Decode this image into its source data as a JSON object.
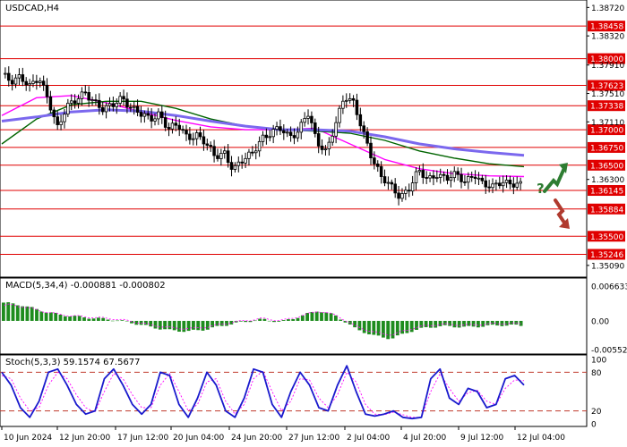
{
  "chart_data": [
    {
      "type": "candlestick",
      "title": "USDCAD,H4",
      "x_labels": [
        "10 Jun 2024",
        "12 Jun 20:00",
        "17 Jun 12:00",
        "20 Jun 04:00",
        "24 Jun 20:00",
        "27 Jun 12:00",
        "2 Jul 04:00",
        "4 Jul 20:00",
        "9 Jul 12:00",
        "12 Jul 04:00"
      ],
      "y_ticks": [
        "1.38720",
        "1.38320",
        "1.37910",
        "1.37510",
        "1.37110",
        "1.36300",
        "1.35090"
      ],
      "ylim": [
        1.3495,
        1.388
      ],
      "levels": [
        {
          "label": "1.38458",
          "value": 1.38458
        },
        {
          "label": "1.38000",
          "value": 1.38
        },
        {
          "label": "1.37623",
          "value": 1.37623
        },
        {
          "label": "1.37338",
          "value": 1.37338
        },
        {
          "label": "1.37000",
          "value": 1.37
        },
        {
          "label": "1.36750",
          "value": 1.3675
        },
        {
          "label": "1.36500",
          "value": 1.365
        },
        {
          "label": "1.36145",
          "value": 1.36145
        },
        {
          "label": "1.35884",
          "value": 1.35884
        },
        {
          "label": "1.35500",
          "value": 1.355
        },
        {
          "label": "1.35246",
          "value": 1.35246
        }
      ],
      "price_anchors": [
        1.3775,
        1.3768,
        1.3778,
        1.376,
        1.377,
        1.3745,
        1.3705,
        1.373,
        1.374,
        1.3755,
        1.374,
        1.3725,
        1.3735,
        1.3748,
        1.373,
        1.372,
        1.3715,
        1.3725,
        1.37,
        1.3705,
        1.369,
        1.3695,
        1.368,
        1.366,
        1.367,
        1.3645,
        1.3655,
        1.3665,
        1.369,
        1.3695,
        1.37,
        1.369,
        1.37,
        1.3725,
        1.368,
        1.367,
        1.371,
        1.3745,
        1.3735,
        1.37,
        1.366,
        1.363,
        1.362,
        1.3608,
        1.3618,
        1.364,
        1.363,
        1.364,
        1.363,
        1.3635,
        1.3628,
        1.364,
        1.362,
        1.3618,
        1.363,
        1.3625,
        1.362
      ],
      "moving_averages": [
        {
          "color": "#ff00ff",
          "values": [
            1.372,
            1.3745,
            1.3748,
            1.3738,
            1.3725,
            1.3713,
            1.3704,
            1.37,
            1.37,
            1.3702,
            1.368,
            1.3658,
            1.3645,
            1.3638,
            1.3635,
            1.3634
          ]
        },
        {
          "color": "#006400",
          "values": [
            1.368,
            1.3715,
            1.3735,
            1.374,
            1.374,
            1.373,
            1.3715,
            1.3705,
            1.37,
            1.3698,
            1.3695,
            1.3685,
            1.367,
            1.366,
            1.3652,
            1.3648
          ]
        },
        {
          "color": "#7b68ee",
          "values": [
            1.3712,
            1.3718,
            1.3725,
            1.3728,
            1.3726,
            1.372,
            1.3712,
            1.3705,
            1.37,
            1.37,
            1.3698,
            1.369,
            1.368,
            1.3673,
            1.3668,
            1.3664
          ]
        }
      ],
      "arrows": [
        {
          "direction": "up",
          "color": "#2e7d32"
        },
        {
          "direction": "down",
          "color": "#b03a2e"
        }
      ],
      "question_mark": "?"
    },
    {
      "type": "histogram",
      "title": "MACD(5,34,4) -0.000881 -0.000802",
      "y_ticks": [
        "0.006633",
        "0.00",
        "-0.005523"
      ],
      "ylim": [
        -0.006,
        0.007
      ],
      "anchors": [
        0.0035,
        0.003,
        0.002,
        0.0012,
        0.0008,
        0.0005,
        0.0002,
        -0.0004,
        -0.0012,
        -0.0018,
        -0.002,
        -0.0016,
        -0.0008,
        -0.0002,
        0.0003,
        -0.0002,
        0.0008,
        0.002,
        0.001,
        -0.0014,
        -0.0028,
        -0.0034,
        -0.002,
        -0.0012,
        -0.001,
        -0.0012,
        -0.001,
        -0.0008,
        -0.0009
      ]
    },
    {
      "type": "line",
      "title": "Stoch(5,3,3) 59.1574 67.5677",
      "y_ticks": [
        "100",
        "80",
        "20",
        "0"
      ],
      "ylim": [
        0,
        100
      ],
      "levels": [
        80,
        20
      ],
      "k_values": [
        80,
        60,
        25,
        10,
        35,
        80,
        85,
        60,
        30,
        15,
        20,
        70,
        85,
        60,
        30,
        15,
        30,
        80,
        75,
        30,
        10,
        40,
        80,
        60,
        20,
        10,
        40,
        85,
        80,
        30,
        10,
        50,
        80,
        60,
        25,
        20,
        60,
        90,
        50,
        15,
        12,
        15,
        20,
        10,
        8,
        10,
        70,
        85,
        40,
        30,
        55,
        50,
        25,
        30,
        70,
        75,
        60
      ],
      "d_values": [
        75,
        70,
        40,
        20,
        25,
        60,
        80,
        70,
        45,
        25,
        18,
        50,
        78,
        70,
        45,
        25,
        25,
        60,
        78,
        50,
        20,
        30,
        65,
        70,
        35,
        15,
        30,
        70,
        82,
        50,
        20,
        35,
        70,
        68,
        40,
        25,
        45,
        80,
        65,
        30,
        15,
        14,
        18,
        14,
        10,
        10,
        50,
        78,
        55,
        35,
        48,
        52,
        35,
        30,
        55,
        68,
        67
      ]
    }
  ]
}
